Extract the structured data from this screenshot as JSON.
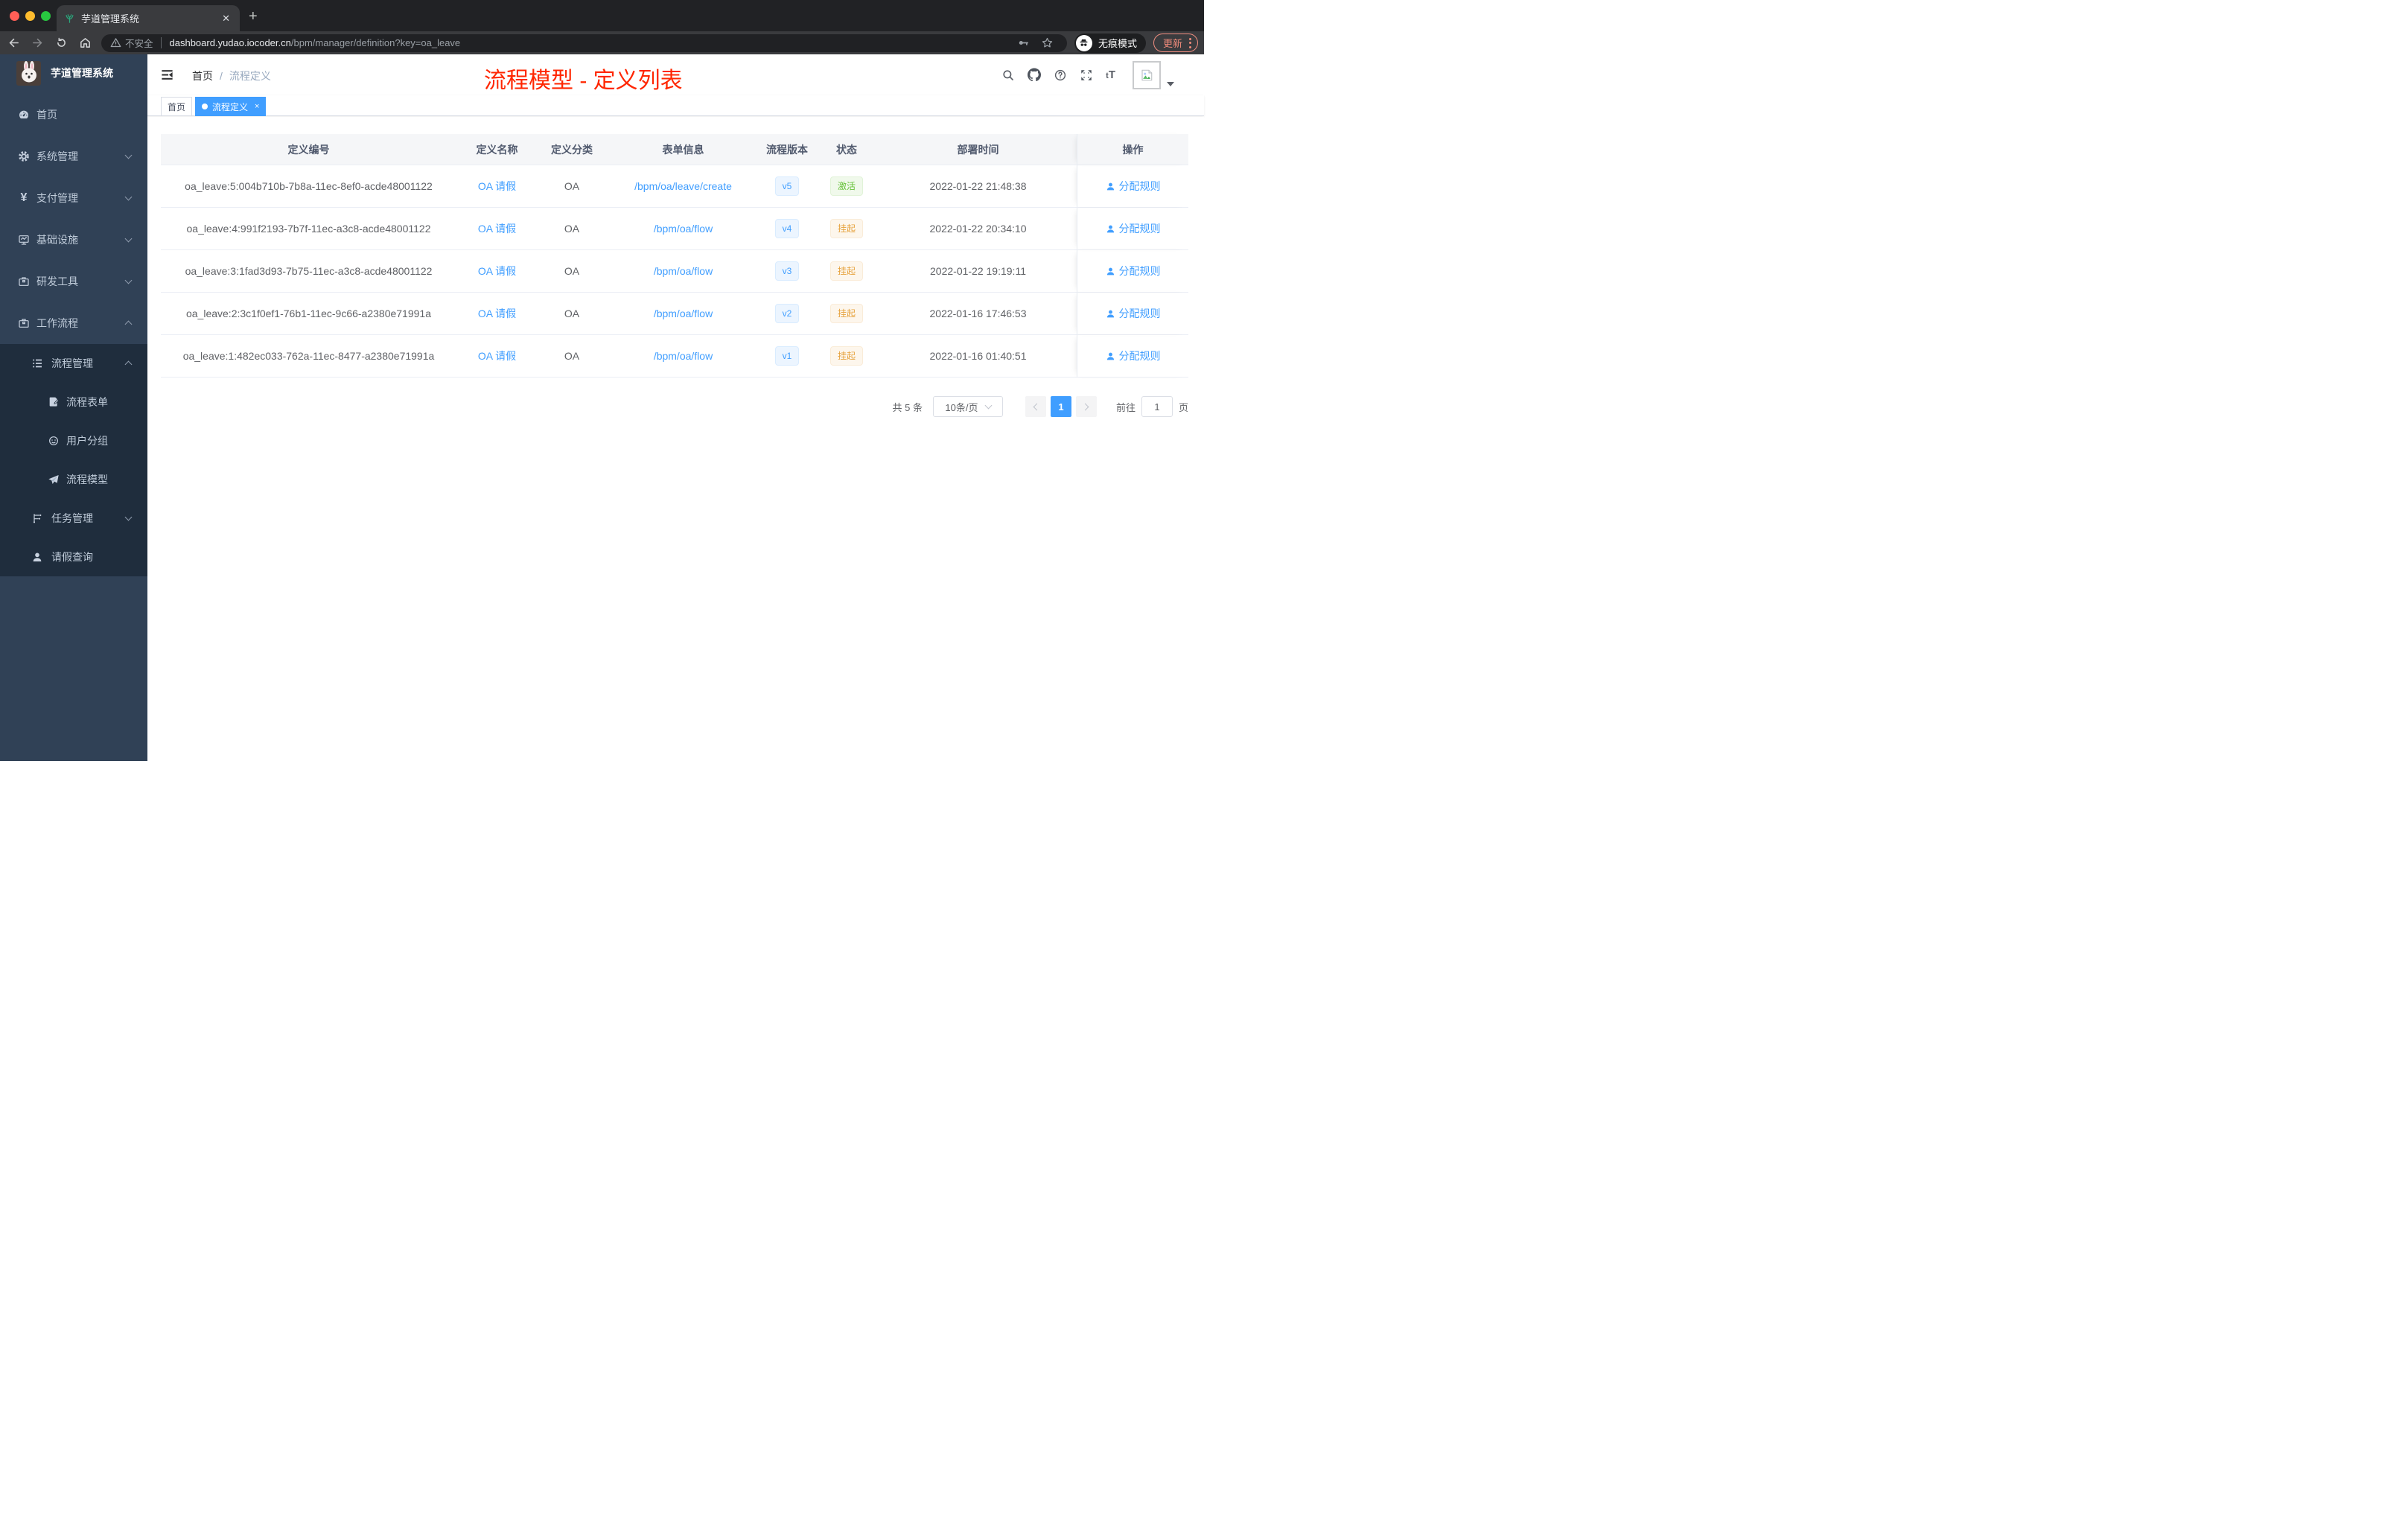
{
  "browser": {
    "tab_title": "芋道管理系统",
    "close_tab": "✕",
    "new_tab": "+",
    "security_label": "不安全",
    "url_host": "dashboard.yudao.iocoder.cn",
    "url_path": "/bpm/manager/definition?key=oa_leave",
    "incognito_label": "无痕模式",
    "update_label": "更新"
  },
  "sidebar": {
    "logo_title": "芋道管理系统",
    "items": [
      {
        "label": "首页",
        "icon": "dashboard-icon",
        "level": 1
      },
      {
        "label": "系统管理",
        "icon": "gear-icon",
        "level": 1,
        "chevron": "down"
      },
      {
        "label": "支付管理",
        "icon": "yen-icon",
        "level": 1,
        "chevron": "down"
      },
      {
        "label": "基础设施",
        "icon": "monitor-icon",
        "level": 1,
        "chevron": "down"
      },
      {
        "label": "研发工具",
        "icon": "briefcase-icon",
        "level": 1,
        "chevron": "down"
      },
      {
        "label": "工作流程",
        "icon": "briefcase-icon",
        "level": 1,
        "chevron": "up"
      },
      {
        "label": "流程管理",
        "icon": "list-icon",
        "level": 2,
        "chevron": "up"
      },
      {
        "label": "流程表单",
        "icon": "form-icon",
        "level": 3
      },
      {
        "label": "用户分组",
        "icon": "group-icon",
        "level": 3
      },
      {
        "label": "流程模型",
        "icon": "paper-plane-icon",
        "level": 3
      },
      {
        "label": "任务管理",
        "icon": "task-icon",
        "level": 2,
        "chevron": "down"
      },
      {
        "label": "请假查询",
        "icon": "user-icon",
        "level": 2
      }
    ]
  },
  "navbar": {
    "breadcrumb_home": "首页",
    "breadcrumb_sep": "/",
    "breadcrumb_current": "流程定义",
    "annotation": "流程模型 - 定义列表",
    "font_icon_small": "t",
    "font_icon_big": "T"
  },
  "tags": {
    "home": "首页",
    "active": "流程定义",
    "close": "×"
  },
  "table": {
    "columns": [
      "定义编号",
      "定义名称",
      "定义分类",
      "表单信息",
      "流程版本",
      "状态",
      "部署时间",
      "操作"
    ],
    "rows": [
      {
        "id": "oa_leave:5:004b710b-7b8a-11ec-8ef0-acde48001122",
        "name": "OA 请假",
        "category": "OA",
        "form": "/bpm/oa/leave/create",
        "version": "v5",
        "status": "激活",
        "time": "2022-01-22 21:48:38",
        "action": "分配规则"
      },
      {
        "id": "oa_leave:4:991f2193-7b7f-11ec-a3c8-acde48001122",
        "name": "OA 请假",
        "category": "OA",
        "form": "/bpm/oa/flow",
        "version": "v4",
        "status": "挂起",
        "time": "2022-01-22 20:34:10",
        "action": "分配规则"
      },
      {
        "id": "oa_leave:3:1fad3d93-7b75-11ec-a3c8-acde48001122",
        "name": "OA 请假",
        "category": "OA",
        "form": "/bpm/oa/flow",
        "version": "v3",
        "status": "挂起",
        "time": "2022-01-22 19:19:11",
        "action": "分配规则"
      },
      {
        "id": "oa_leave:2:3c1f0ef1-76b1-11ec-9c66-a2380e71991a",
        "name": "OA 请假",
        "category": "OA",
        "form": "/bpm/oa/flow",
        "version": "v2",
        "status": "挂起",
        "time": "2022-01-16 17:46:53",
        "action": "分配规则"
      },
      {
        "id": "oa_leave:1:482ec033-762a-11ec-8477-a2380e71991a",
        "name": "OA 请假",
        "category": "OA",
        "form": "/bpm/oa/flow",
        "version": "v1",
        "status": "挂起",
        "time": "2022-01-16 01:40:51",
        "action": "分配规则"
      }
    ]
  },
  "pagination": {
    "total": "共 5 条",
    "page_size": "10条/页",
    "current_page": "1",
    "goto_label": "前往",
    "goto_value": "1",
    "unit_label": "页"
  },
  "colors": {
    "accent": "#409eff",
    "success": "#67c23a",
    "warning": "#e6a23c",
    "annotation_red": "#ff2600",
    "sidebar_bg": "#304156",
    "submenu_bg": "#1f2d3d",
    "update_salmon": "#f08b7b"
  }
}
